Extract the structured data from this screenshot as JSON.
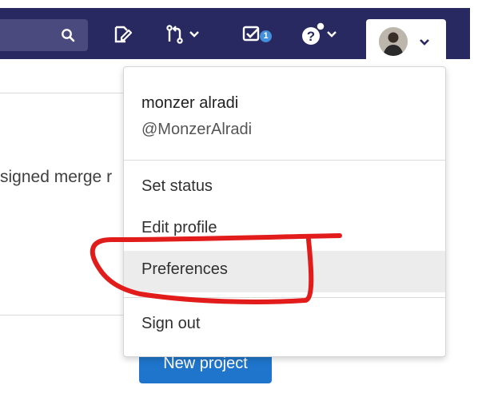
{
  "navbar": {
    "search_icon": "search-icon",
    "icons": [
      "issues-icon",
      "merge-request-icon",
      "chevron-down-icon",
      "todo-icon",
      "help-icon",
      "chevron-down-icon"
    ],
    "todo_count": "1",
    "colors": {
      "navbar": "#292961",
      "search": "#4a4a7e",
      "badge": "#428fdc"
    }
  },
  "page": {
    "partial_text": "signed merge r",
    "new_project_label": "New project",
    "button_color": "#1f75cb"
  },
  "user_menu": {
    "name": "monzer alradi",
    "username": "@MonzerAlradi",
    "items": [
      {
        "label": "Set status"
      },
      {
        "label": "Edit profile"
      },
      {
        "label": "Preferences",
        "highlighted": true
      },
      {
        "label": "Sign out"
      }
    ]
  },
  "annotation": {
    "color": "#e21b1b",
    "shape": "freehand-circle-around-preferences"
  }
}
